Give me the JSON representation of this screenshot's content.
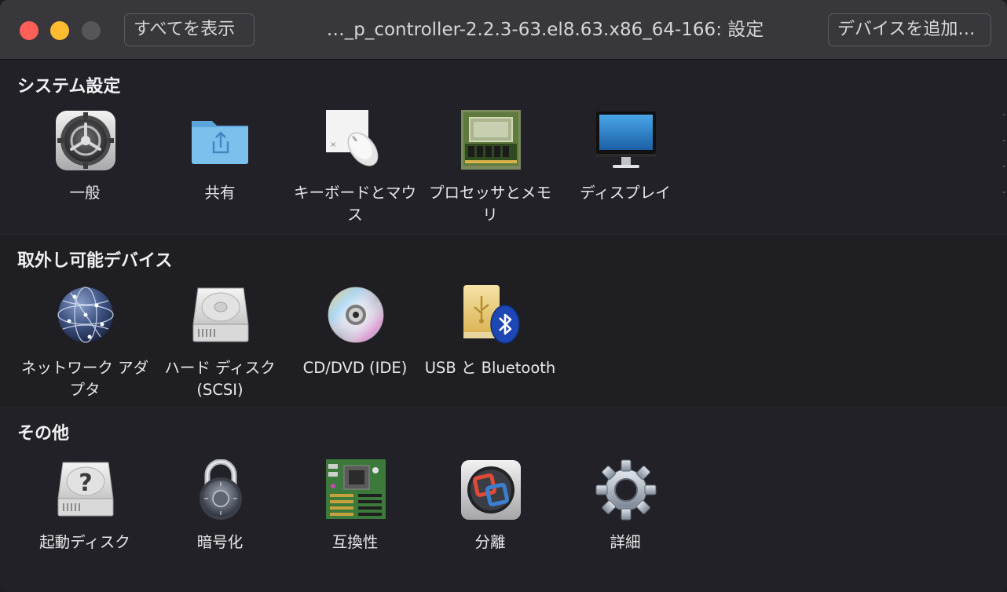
{
  "window": {
    "title": "…_p_controller-2.2.3-63.el8.63.x86_64-166: 設定",
    "show_all_label": "すべてを表示",
    "add_device_label": "デバイスを追加…"
  },
  "sections": [
    {
      "title": "システム設定",
      "items": [
        {
          "label": "一般",
          "icon": "gear-general-icon"
        },
        {
          "label": "共有",
          "icon": "shared-folder-icon"
        },
        {
          "label": "キーボードとマウス",
          "icon": "keyboard-mouse-icon"
        },
        {
          "label": "プロセッサとメモリ",
          "icon": "processor-memory-icon"
        },
        {
          "label": "ディスプレイ",
          "icon": "display-icon"
        }
      ]
    },
    {
      "title": "取外し可能デバイス",
      "items": [
        {
          "label": "ネットワーク アダプタ",
          "icon": "network-globe-icon"
        },
        {
          "label": "ハード ディスク (SCSI)",
          "icon": "hard-disk-icon"
        },
        {
          "label": "CD/DVD (IDE)",
          "icon": "cd-dvd-icon"
        },
        {
          "label": "USB と Bluetooth",
          "icon": "usb-bluetooth-icon"
        }
      ]
    },
    {
      "title": "その他",
      "items": [
        {
          "label": "起動ディスク",
          "icon": "startup-disk-icon"
        },
        {
          "label": "暗号化",
          "icon": "padlock-icon"
        },
        {
          "label": "互換性",
          "icon": "motherboard-icon"
        },
        {
          "label": "分離",
          "icon": "isolation-icon"
        },
        {
          "label": "詳細",
          "icon": "gear-advanced-icon"
        }
      ]
    }
  ]
}
